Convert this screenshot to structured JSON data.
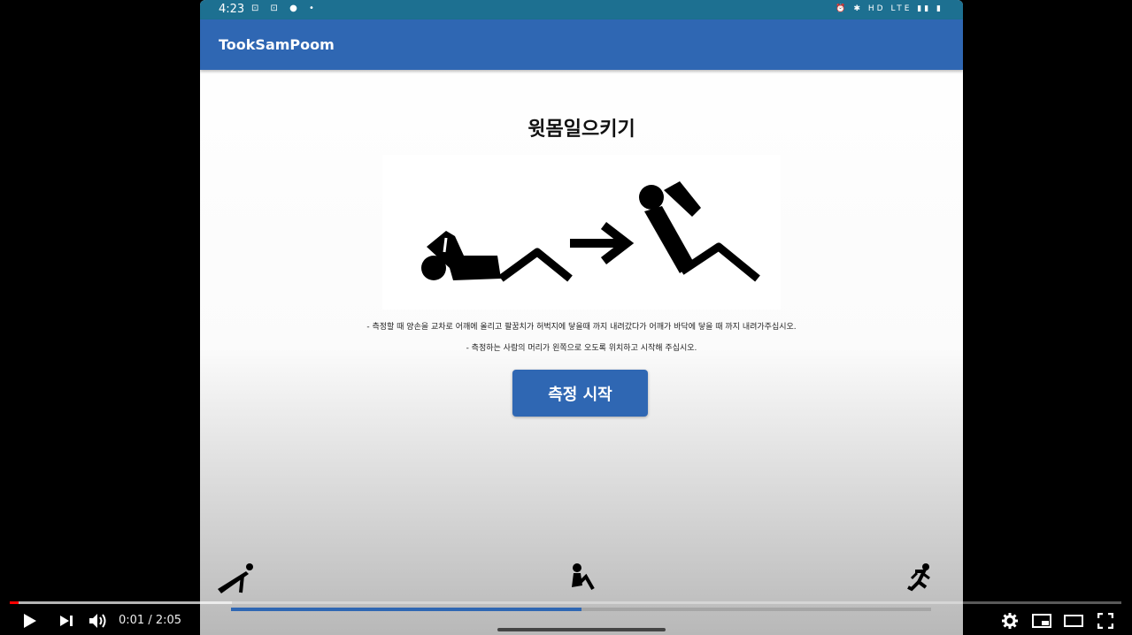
{
  "phone": {
    "status_time": "4:23",
    "status_left_icons": "⊡ ⊡ ●  •",
    "status_right_icons": "⏰ ✱ HD LTE ▮▮ ▮",
    "app_title": "TookSamPoom",
    "heading": "윗몸일으키기",
    "instructions": [
      "- 측정할 때 양손을 교차로 어깨에 올리고 팔꿈치가 허벅지에 닿을때 까지 내려갔다가 어깨가 바닥에 닿을 때 까지 내려가주십시오.",
      "- 측정하는 사람의 머리가 왼쪽으로 오도록 위치하고 시작해 주십시오."
    ],
    "start_button": "측정 시작",
    "progress_fraction": 0.5,
    "nav": [
      "pushup-icon",
      "situp-icon",
      "running-icon"
    ]
  },
  "player": {
    "current_time": "0:01",
    "separator": " / ",
    "duration": "2:05",
    "played_fraction": 0.008,
    "loaded_fraction": 0.2
  },
  "colors": {
    "status_bar": "#1d7091",
    "app_bar": "#2f67b3",
    "progress_red": "#ff0000"
  }
}
